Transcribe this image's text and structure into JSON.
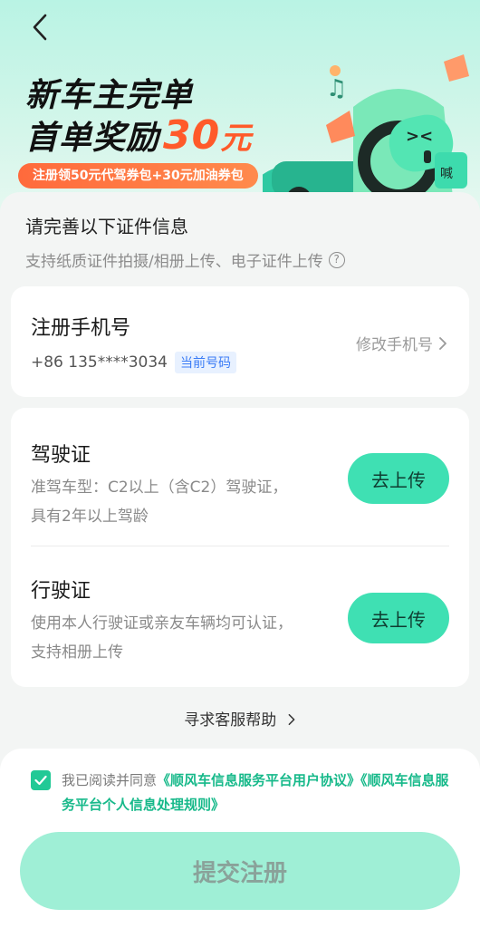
{
  "banner": {
    "headline_line1": "新车主完单",
    "headline_line2_prefix": "首单奖励",
    "headline_amount": "30",
    "headline_unit": "元",
    "promo_pill": "注册领50元代驾券包+30元加油券包",
    "accent_color": "#ff5a2a"
  },
  "section": {
    "title": "请完善以下证件信息",
    "subtitle": "支持纸质证件拍摄/相册上传、电子证件上传",
    "help_icon": "?"
  },
  "phone_card": {
    "title": "注册手机号",
    "number": "+86 135****3034",
    "badge": "当前号码",
    "modify_label": "修改手机号"
  },
  "documents": [
    {
      "title": "驾驶证",
      "description": "准驾车型：C2以上（含C2）驾驶证，具有2年以上驾龄",
      "button": "去上传"
    },
    {
      "title": "行驶证",
      "description": "使用本人行驶证或亲友车辆均可认证，支持相册上传",
      "button": "去上传"
    }
  ],
  "service_link": "寻求客服帮助",
  "agreement": {
    "checked": true,
    "prefix": "我已阅读并同意",
    "link1": "《顺风车信息服务平台用户协议》",
    "link2": "《顺风车信息服务平台个人信息处理规则》"
  },
  "submit_label": "提交注册",
  "colors": {
    "brand_green": "#3fe0b3",
    "link_green": "#17b98a",
    "submit_disabled": "#9fefd6"
  }
}
